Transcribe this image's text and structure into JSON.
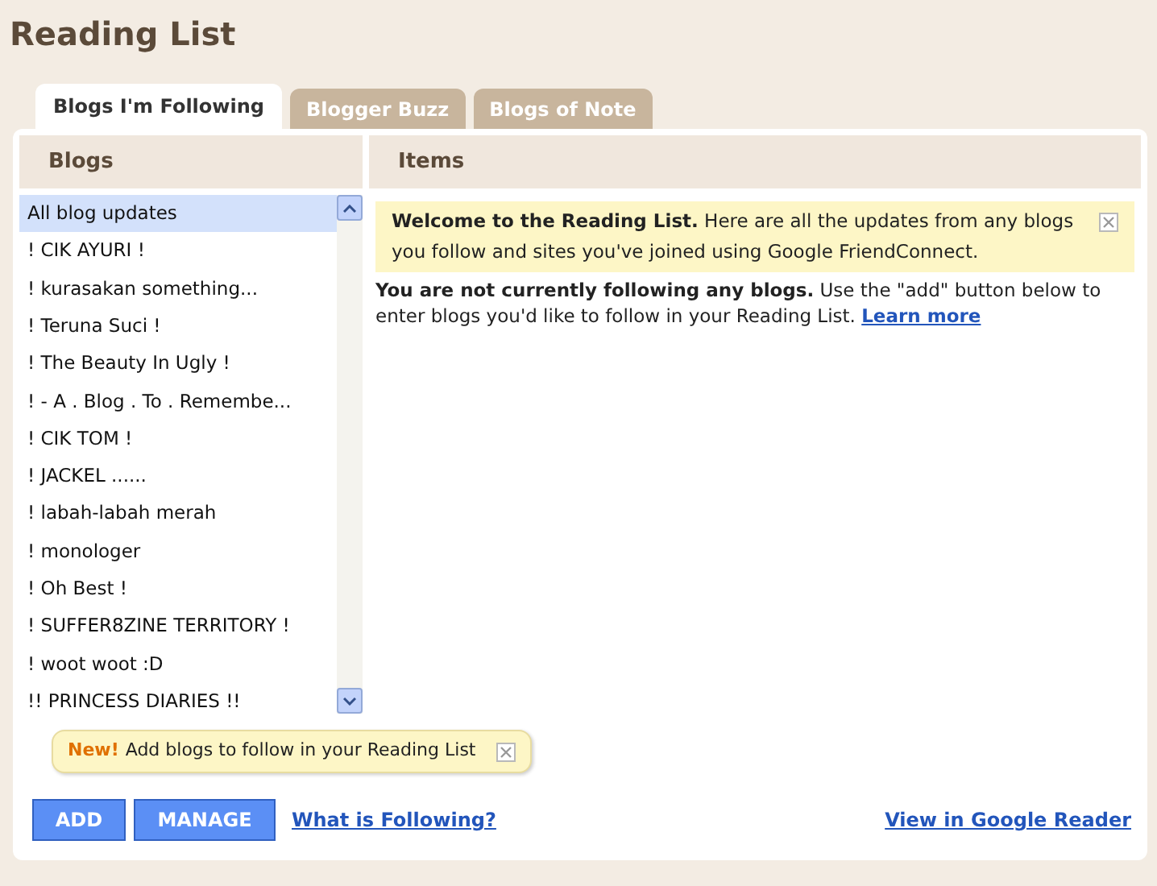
{
  "title": "Reading List",
  "tabs": [
    {
      "label": "Blogs I'm Following",
      "selected": true
    },
    {
      "label": "Blogger Buzz",
      "selected": false
    },
    {
      "label": "Blogs of Note",
      "selected": false
    }
  ],
  "blogs": {
    "heading": "Blogs",
    "items": [
      {
        "label": "All blog updates",
        "selected": true
      },
      {
        "label": "! CIK AYURI !",
        "selected": false
      },
      {
        "label": "! kurasakan something...",
        "selected": false
      },
      {
        "label": "! Teruna Suci !",
        "selected": false
      },
      {
        "label": "! The Beauty In Ugly !",
        "selected": false
      },
      {
        "label": "! - A . Blog . To . Remembe...",
        "selected": false
      },
      {
        "label": "! CIK TOM !",
        "selected": false
      },
      {
        "label": "! JACKEL ......",
        "selected": false
      },
      {
        "label": "! labah-labah merah",
        "selected": false
      },
      {
        "label": "! monologer",
        "selected": false
      },
      {
        "label": "! Oh Best !",
        "selected": false
      },
      {
        "label": "! SUFFER8ZINE TERRITORY !",
        "selected": false
      },
      {
        "label": "! woot woot :D",
        "selected": false
      },
      {
        "label": "!! PRINCESS DIARIES !!",
        "selected": false
      }
    ]
  },
  "items": {
    "heading": "Items",
    "welcome": "**Welcome to the Reading List.** Here are all the updates from any blogs you follow and sites you've joined using Google FriendConnect.",
    "notice": "**You are not currently following any blogs.** Use the \"add\" button below to enter blogs you'd like to follow in your Reading List.",
    "learn_more": "Learn more"
  },
  "tip": {
    "badge": "New!",
    "text": "Add blogs to follow in your Reading List"
  },
  "buttons": [
    "ADD",
    "MANAGE"
  ],
  "links": {
    "what_is": "What is Following?",
    "reader": "View in Google Reader"
  }
}
